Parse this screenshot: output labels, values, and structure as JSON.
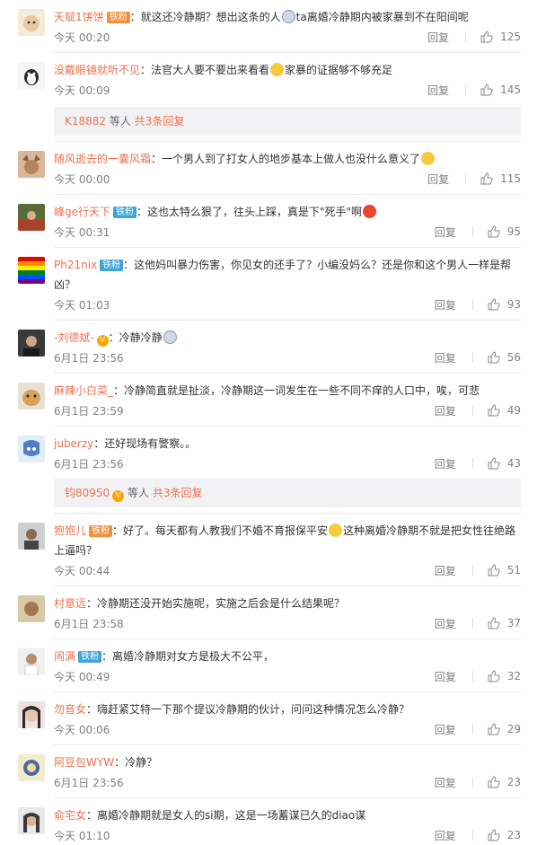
{
  "comments": [
    {
      "user": "天赋1饼饼",
      "badge": "",
      "vip": true,
      "text_a": "：就这还冷静期？想出这条的人",
      "mention": "ta",
      "text_b": "离婚冷静期内被家暴到不在阳间呢",
      "time": "今天 00:20",
      "likes": "125"
    },
    {
      "user": "没戴眼镜就听不见",
      "badge": "",
      "vip": false,
      "text_a": "：法官大人要不要出来看看",
      "emoji": true,
      "text_b": "家暴的证据够不够充足",
      "time": "今天 00:09",
      "likes": "145"
    },
    {
      "user": "随风逝去的一囊风霜",
      "badge": "",
      "vip": false,
      "text_a": "：一个男人到了打女人的地步基本上做人也没什么意义了",
      "time": "今天 00:00",
      "likes": "115"
    },
    {
      "user": "峰ge行天下",
      "badge": "铁粉",
      "vip": false,
      "text_a": "：这也太特么狠了，往头上踩，真是下\"死手\"啊",
      "time": "今天 00:31",
      "likes": "95"
    },
    {
      "user": "Ph21nix",
      "badge": "铁粉",
      "vip": false,
      "text_a": "：这他妈叫暴力伤害，你见女的还手了？小编没妈么？还是你和这个男人一样是帮凶？",
      "time": "今天 01:03",
      "likes": "93"
    },
    {
      "user": "-刘德斌-",
      "badge": "",
      "vip": true,
      "text_a": "：冷静冷静",
      "time": "6月1日 23:56",
      "likes": "56"
    },
    {
      "user": "麻辣小白菜_",
      "badge": "",
      "vip": false,
      "text_a": "：冷静简直就是扯淡，冷静期这一词发生在一些不同不痒的人口中，唉，可悲",
      "time": "6月1日 23:59",
      "likes": "49"
    },
    {
      "user": "juberzy",
      "badge": "",
      "vip": false,
      "text_a": "：还好现场有警察。。",
      "time": "6月1日 23:56",
      "likes": "43"
    },
    {
      "user": "狍狍儿",
      "badge": "铁粉",
      "vip": true,
      "text_a": "：好了。每天都有人教我们不婚不育报保平安",
      "text_b": "这种离婚冷静期不就是把女性往绝路上逼吗？",
      "time": "今天 00:44",
      "likes": "51"
    },
    {
      "user": "村意远",
      "badge": "",
      "vip": false,
      "text_a": "：冷静期还没开始实施呢，实施之后会是什么结果呢？",
      "time": "6月1日 23:58",
      "likes": "37"
    },
    {
      "user": "闹满",
      "badge": "铁粉",
      "vip": false,
      "text_a": "：离婚冷静期对女方是极大不公平，",
      "time": "今天 00:49",
      "likes": "32"
    },
    {
      "user": "勿音女",
      "badge": "",
      "vip": false,
      "text_a": "：嗨赶紧艾特一下那个提议冷静期的伙计，问问这种情况怎么冷静？",
      "time": "今天 00:06",
      "likes": "29"
    },
    {
      "user": "阿豆包WYW",
      "badge": "",
      "vip": false,
      "text_a": "：冷静？",
      "time": "6月1日 23:56",
      "likes": "23"
    },
    {
      "user": "俞宅女",
      "badge": "",
      "vip": false,
      "text_a": "：离婚冷静期就是女人的si期，这是一场蓄谋已久的diao谋",
      "time": "今天 01:10",
      "likes": "23"
    }
  ],
  "more_replies": [
    {
      "user": "K18882",
      "text": " 等人 ",
      "link": "共3条回复"
    },
    {
      "user": "钧80950",
      "text": " 等人 ",
      "link": "共3条回复"
    }
  ],
  "reply_label": "回复"
}
